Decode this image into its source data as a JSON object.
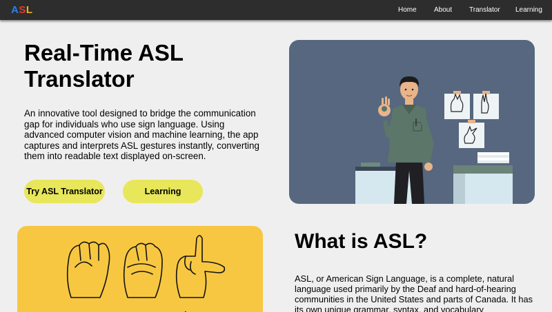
{
  "nav": {
    "logo": [
      "A",
      "S",
      "L"
    ],
    "links": [
      "Home",
      "About",
      "Translator",
      "Learning"
    ]
  },
  "hero": {
    "title": "Real-Time ASL Translator",
    "description": "An innovative tool designed to bridge the communication gap for individuals who use sign language. Using advanced computer vision and machine learning, the app captures and interprets ASL gestures instantly, converting them into readable text displayed on-screen.",
    "primary_button": "Try ASL Translator",
    "secondary_button": "Learning"
  },
  "about": {
    "title": "What is ASL?",
    "description": "ASL, or American Sign Language, is a complete, natural language used primarily by the Deaf and hard-of-hearing communities in the United States and parts of Canada. It has its own unique grammar, syntax, and vocabulary"
  },
  "colors": {
    "navbar": "#2d2d2d",
    "background": "#efefef",
    "button": "#e8e65a",
    "illustration_bg": "#56677f",
    "card_yellow": "#f7c742"
  }
}
